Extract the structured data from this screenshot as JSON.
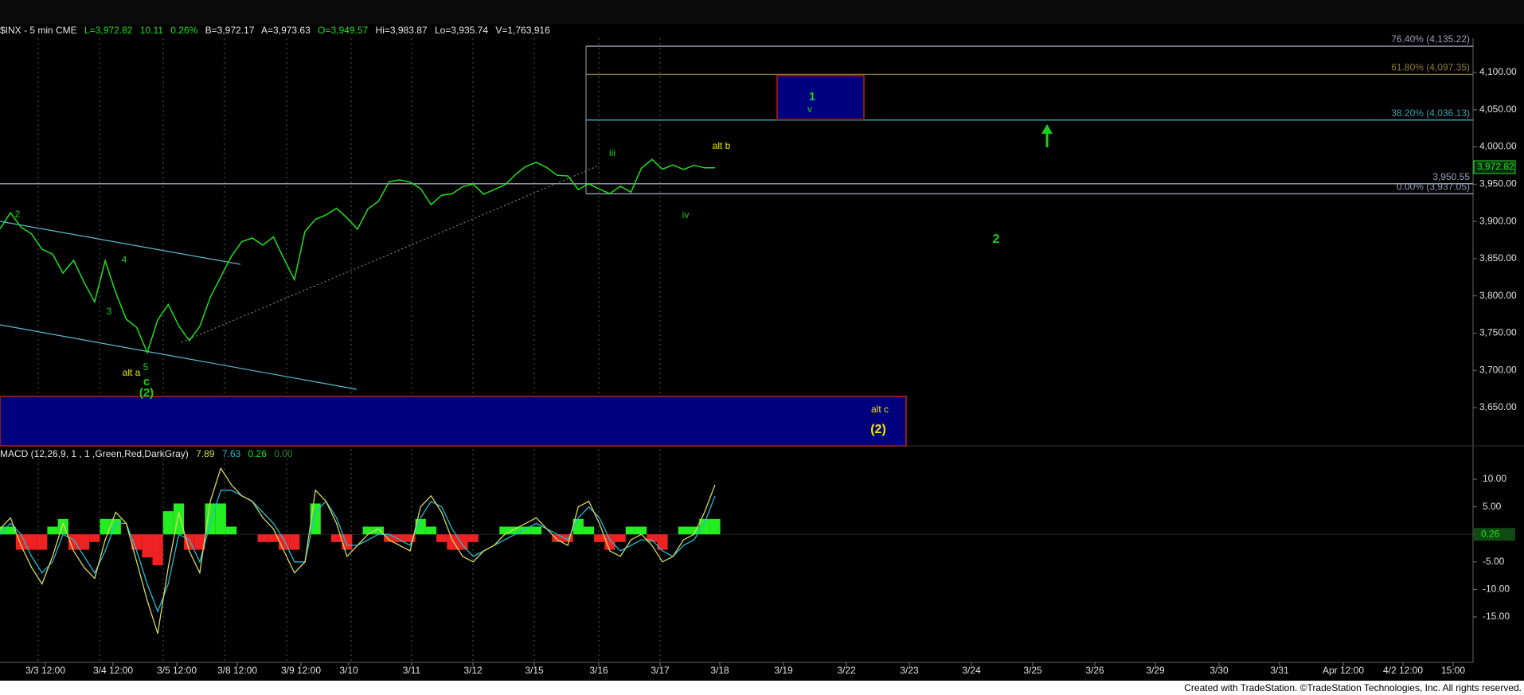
{
  "header": {
    "symbol": "$INX - 5 min  CME",
    "last": "L=3,972.82",
    "change": "10.11",
    "pct": "0.26%",
    "bid": "B=3,972.17",
    "ask": "A=3,973.63",
    "open": "O=3,949.57",
    "high": "Hi=3,983.87",
    "low": "Lo=3,935.74",
    "volume": "V=1,763,916"
  },
  "macd_header": {
    "label": "MACD (12,26,9, 1 , 1 ,Green,Red,DarkGray)",
    "macd": "7.89",
    "signal": "7.63",
    "hist": "0.26",
    "zero": "0.00"
  },
  "footer": "Created with TradeStation. ©TradeStation Technologies, Inc. All rights reserved.",
  "colors": {
    "price": "#1fe01f",
    "macd_line": "#d8d860",
    "signal_line": "#22bcd8",
    "hist_pos": "#22ee22",
    "hist_neg": "#ee2222",
    "box_fill": "#00007f",
    "box_border": "#8b1a1a",
    "label_yellow": "#f2e600",
    "label_green": "#19d019",
    "fib_gray": "#9aa2b8",
    "fib_gold": "#8b7a3a",
    "fib_teal": "#3aa0a8",
    "channel": "#5dbcd0"
  },
  "chart_data": [
    {
      "type": "line",
      "title": "$INX - 5 min",
      "x_ticks": [
        "3/3 12:00",
        "3/4 12:00",
        "3/5 12:00",
        "3/8 12:00",
        "3/9 12:00",
        "3/10",
        "3/11",
        "3/12",
        "3/15",
        "3/16",
        "3/17",
        "3/18",
        "3/19",
        "3/22",
        "3/23",
        "3/24",
        "3/25",
        "3/26",
        "3/29",
        "3/30",
        "3/31",
        "Apr 12:00",
        "4/2 12:00",
        "15:00"
      ],
      "y_ticks": [
        "4,100.00",
        "4,050.00",
        "4,000.00",
        "3,950.00",
        "3,900.00",
        "3,850.00",
        "3,800.00",
        "3,750.00",
        "3,700.00",
        "3,650.00"
      ],
      "ylim": [
        3590,
        4170
      ],
      "series": [
        {
          "name": "$INX",
          "x": [
            0,
            1,
            2,
            3,
            4,
            5,
            6,
            7,
            8,
            9,
            10,
            11,
            12,
            13,
            14,
            15,
            16,
            17,
            18,
            19,
            20,
            21,
            22,
            23,
            24,
            25,
            26,
            27,
            28,
            29,
            30,
            31,
            32,
            33,
            34,
            35,
            36,
            37,
            38,
            39,
            40,
            41,
            42,
            43,
            44,
            45,
            46,
            47,
            48,
            49,
            50,
            51,
            52,
            53,
            54,
            55,
            56,
            57,
            58,
            59,
            60,
            61,
            62,
            63,
            64,
            65,
            66,
            67,
            68
          ],
          "y": [
            3890,
            3910,
            3895,
            3880,
            3865,
            3855,
            3830,
            3850,
            3815,
            3795,
            3845,
            3805,
            3770,
            3755,
            3727,
            3765,
            3790,
            3760,
            3738,
            3762,
            3795,
            3828,
            3852,
            3872,
            3880,
            3865,
            3882,
            3848,
            3822,
            3888,
            3900,
            3912,
            3915,
            3906,
            3890,
            3915,
            3930,
            3950,
            3958,
            3952,
            3943,
            3925,
            3932,
            3940,
            3945,
            3950,
            3938,
            3940,
            3952,
            3960,
            3975,
            3980,
            3970,
            3965,
            3958,
            3945,
            3950,
            3942,
            3940,
            3944,
            3942,
            3970,
            3983,
            3972,
            3972.82,
            3972.82,
            3972.82,
            3972.82,
            3972.82
          ]
        }
      ],
      "levels": [
        {
          "label": "76.40% (4,135.22)",
          "value": 4135.22
        },
        {
          "label": "61.80% (4,097.35)",
          "value": 4097.35
        },
        {
          "label": "38.20% (4,036.13)",
          "value": 4036.13
        },
        {
          "label": "0.00% (3,937.05)",
          "value": 3937.05
        },
        {
          "label": "3,950.55",
          "value": 3950.55
        }
      ],
      "last_value": "3,972.82",
      "wave_labels": [
        "2",
        "4",
        "3",
        "5",
        "alt a",
        "c",
        "(2)",
        "iii",
        "alt b",
        "iv",
        "1",
        "v",
        "2",
        "alt c",
        "(2)"
      ]
    },
    {
      "type": "line",
      "title": "MACD (12,26,9, 1 , 1 ,Green,Red,DarkGray)",
      "y_ticks": [
        "10.00",
        "5.00",
        "0.00",
        "-5.00",
        "-10.00",
        "-15.00"
      ],
      "ylim": [
        -19.5,
        13
      ],
      "series": [
        {
          "name": "MACD",
          "y": [
            1,
            3,
            -2,
            -6,
            -9,
            -4,
            2,
            -3,
            -6,
            -8,
            -1,
            4,
            2,
            -5,
            -12,
            -18,
            -6,
            4,
            -3,
            -7,
            6,
            12,
            9,
            7,
            6,
            3,
            1,
            -3,
            -7,
            -5,
            8,
            6,
            2,
            -4,
            -2,
            0,
            1,
            -1,
            -2,
            -3,
            5,
            7,
            4,
            -1,
            -4,
            -5,
            -3,
            -2,
            0,
            1,
            2,
            3,
            1,
            -1,
            -2,
            5,
            6,
            2,
            -3,
            -4,
            -1,
            0,
            -2,
            -5,
            -4,
            -1,
            0,
            4,
            9
          ]
        },
        {
          "name": "Signal",
          "y": [
            0,
            2,
            0,
            -4,
            -7,
            -5,
            0,
            -1,
            -4,
            -7,
            -3,
            2,
            2,
            -3,
            -9,
            -14,
            -9,
            0,
            -1,
            -5,
            2,
            8,
            8,
            7,
            6,
            4,
            2,
            -1,
            -5,
            -5,
            4,
            6,
            3,
            -2,
            -2,
            -1,
            0,
            0,
            -1,
            -2,
            3,
            6,
            5,
            1,
            -2,
            -4,
            -3,
            -2,
            -1,
            0,
            1,
            2,
            1,
            0,
            -1,
            3,
            5,
            3,
            -1,
            -3,
            -2,
            -1,
            -1,
            -3,
            -4,
            -2,
            -1,
            2,
            7
          ]
        }
      ],
      "zero": 0
    }
  ]
}
